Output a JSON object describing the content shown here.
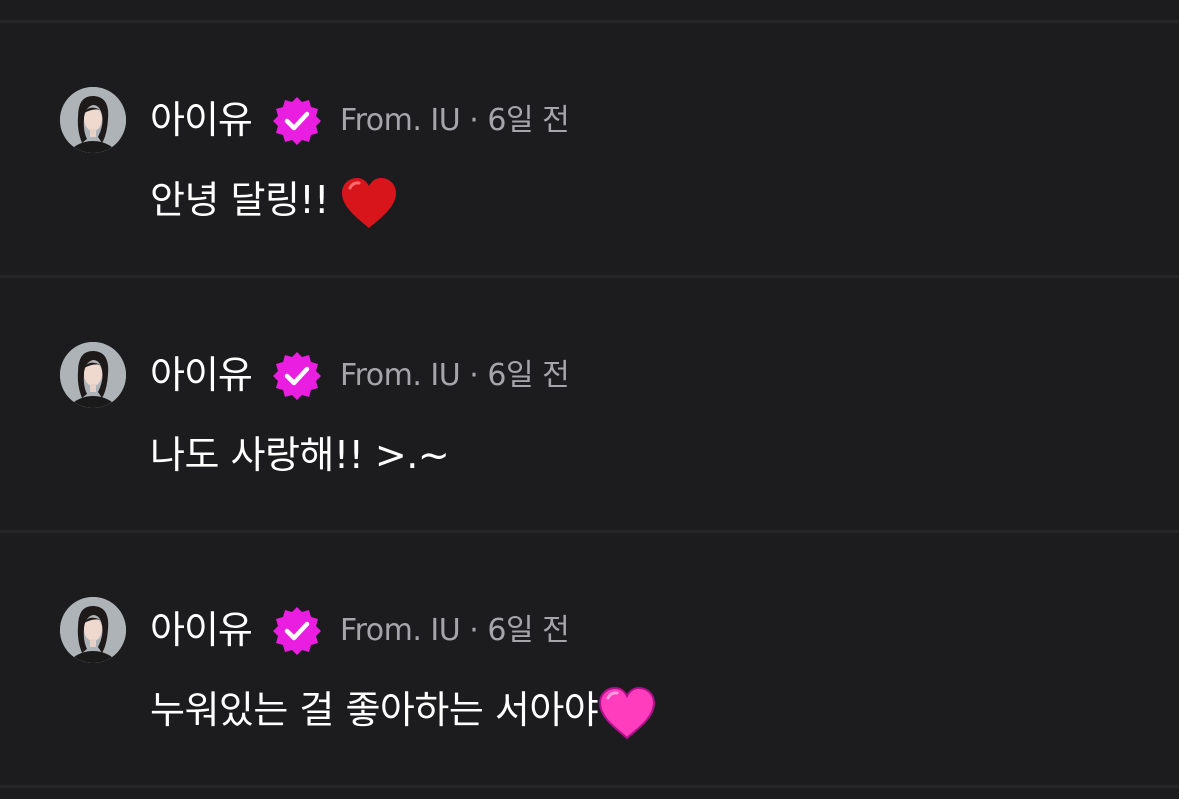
{
  "messages": [
    {
      "author": "아이유",
      "source": "From. IU",
      "separator": "·",
      "time": "6일 전",
      "text": "안녕 달링!! ",
      "emoji": "red-heart"
    },
    {
      "author": "아이유",
      "source": "From. IU",
      "separator": "·",
      "time": "6일 전",
      "text": "나도 사랑해!! >.~",
      "emoji": ""
    },
    {
      "author": "아이유",
      "source": "From. IU",
      "separator": "·",
      "time": "6일 전",
      "text": "누워있는 걸 좋아하는 서아야",
      "emoji": "pink-heart"
    }
  ],
  "colors": {
    "background": "#1c1c1e",
    "divider": "#262628",
    "verified_badge": "#e91ee0",
    "meta_text": "#a5a5aa",
    "red_heart": "#d8151b",
    "pink_heart": "#ff3dbd"
  }
}
